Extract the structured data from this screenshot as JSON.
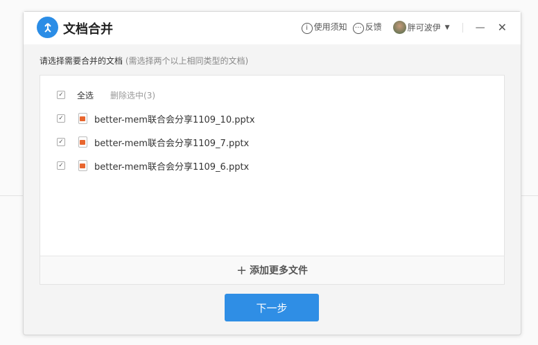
{
  "header": {
    "title": "文档合并",
    "help": "使用须知",
    "feedback": "反馈",
    "user": "胖可波伊"
  },
  "instruction": {
    "main": "请选择需要合并的文档",
    "hint": "(需选择两个以上相同类型的文档)"
  },
  "list": {
    "select_all": "全选",
    "delete_selected": "删除选中(3)",
    "files": [
      {
        "name": "better-mem联合会分享1109_10.pptx",
        "checked": true
      },
      {
        "name": "better-mem联合会分享1109_7.pptx",
        "checked": true
      },
      {
        "name": "better-mem联合会分享1109_6.pptx",
        "checked": true
      }
    ],
    "add_more": "添加更多文件"
  },
  "next_button": "下一步"
}
